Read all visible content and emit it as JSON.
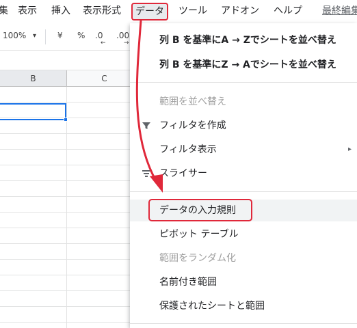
{
  "menubar": {
    "items": [
      "集",
      "表示",
      "挿入",
      "表示形式",
      "データ",
      "ツール",
      "アドオン",
      "ヘルプ",
      "最終編集"
    ]
  },
  "toolbar": {
    "zoom": "100%",
    "zoom_arrow": "▾",
    "currency": "¥",
    "percent": "%",
    "dec_decrease": ".0",
    "dec_increase": ".00",
    "dec_decrease_arrow": "←",
    "dec_increase_arrow": "→"
  },
  "grid": {
    "columns": [
      "B",
      "C"
    ]
  },
  "data_menu": {
    "items": [
      {
        "label": "列 B を基準にA → Zでシートを並べ替え",
        "disabled": false
      },
      {
        "label": "列 B を基準にZ → Aでシートを並べ替え",
        "disabled": false
      },
      {
        "label": "範囲を並べ替え",
        "disabled": true
      },
      {
        "label": "フィルタを作成",
        "disabled": false,
        "icon": "filter-icon"
      },
      {
        "label": "フィルタ表示",
        "disabled": false,
        "submenu": "▸"
      },
      {
        "label": "スライサー",
        "disabled": false,
        "icon": "slicer-icon"
      },
      {
        "label": "データの入力規則",
        "disabled": false,
        "highlighted": true
      },
      {
        "label": "ピボット テーブル",
        "disabled": false
      },
      {
        "label": "範囲をランダム化",
        "disabled": true
      },
      {
        "label": "名前付き範囲",
        "disabled": false
      },
      {
        "label": "保護されたシートと範囲",
        "disabled": false
      }
    ]
  },
  "colors": {
    "annotation_red": "#e0283a",
    "selection_blue": "#1a73e8"
  }
}
